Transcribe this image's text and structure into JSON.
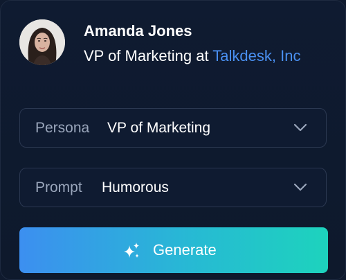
{
  "profile": {
    "name": "Amanda Jones",
    "role_prefix": "VP of Marketing at ",
    "company": "Talkdesk, Inc"
  },
  "persona": {
    "label": "Persona",
    "value": "VP of Marketing",
    "icon": "chevron-down-icon"
  },
  "prompt": {
    "label": "Prompt",
    "value": "Humorous",
    "icon": "chevron-down-icon"
  },
  "generate": {
    "label": "Generate",
    "icon": "sparkles-icon"
  },
  "colors": {
    "background": "#0f1b31",
    "link": "#4a90f2",
    "button_gradient_start": "#3c8ff0",
    "button_gradient_end": "#1dd3bd",
    "field_border": "#2b3851"
  }
}
